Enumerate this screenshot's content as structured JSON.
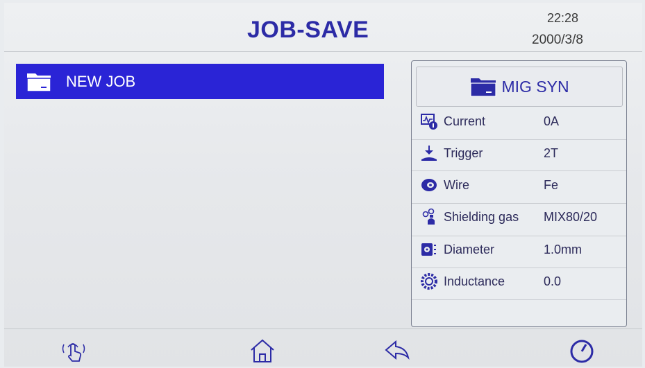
{
  "header": {
    "title": "JOB-SAVE",
    "time": "22:28",
    "date": "2000/3/8"
  },
  "job_list": {
    "items": [
      {
        "label": "NEW  JOB",
        "icon": "folder-icon",
        "selected": true
      }
    ]
  },
  "panel": {
    "title": "MIG  SYN",
    "icon": "folder-icon",
    "params": [
      {
        "name": "Current",
        "value": "0A",
        "icon": "current-icon"
      },
      {
        "name": "Trigger",
        "value": "2T",
        "icon": "trigger-icon"
      },
      {
        "name": "Wire",
        "value": "Fe",
        "icon": "wire-spool-icon"
      },
      {
        "name": "Shielding gas",
        "value": "MIX80/20",
        "icon": "gas-icon"
      },
      {
        "name": "Diameter",
        "value": "1.0mm",
        "icon": "diameter-icon"
      },
      {
        "name": "Inductance",
        "value": "0.0",
        "icon": "inductance-icon"
      }
    ]
  },
  "footer": {
    "icons": [
      "touch-icon",
      "home-icon",
      "back-icon",
      "knob-icon"
    ]
  },
  "colors": {
    "accent": "#2c2ba6",
    "selection": "#2a24d6"
  }
}
